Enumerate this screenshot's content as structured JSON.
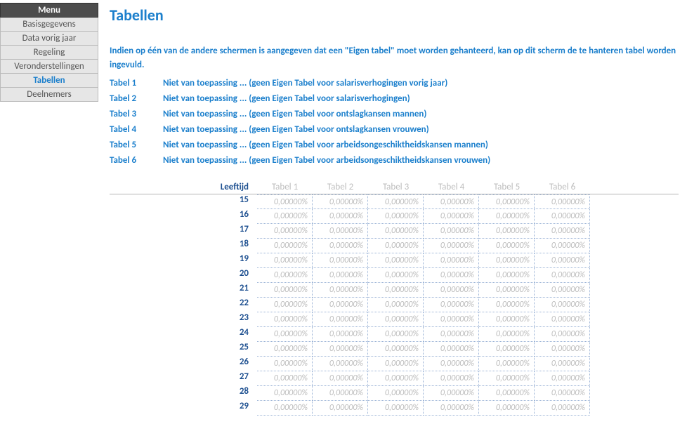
{
  "sidebar": {
    "header": "Menu",
    "items": [
      {
        "label": "Basisgegevens",
        "active": false
      },
      {
        "label": "Data vorig jaar",
        "active": false
      },
      {
        "label": "Regeling",
        "active": false
      },
      {
        "label": "Veronderstellingen",
        "active": false
      },
      {
        "label": "Tabellen",
        "active": true
      },
      {
        "label": "Deelnemers",
        "active": false
      }
    ]
  },
  "main": {
    "title": "Tabellen",
    "intro": "Indien op één van de andere schermen is aangegeven dat een \"Eigen tabel\" moet worden gehanteerd, kan op dit scherm de te hanteren tabel worden ingevuld.",
    "tabellen": [
      {
        "name": "Tabel 1",
        "desc": "Niet van toepassing ... (geen Eigen Tabel voor salarisverhogingen vorig jaar)"
      },
      {
        "name": "Tabel 2",
        "desc": "Niet van toepassing ... (geen Eigen Tabel voor salarisverhogingen)"
      },
      {
        "name": "Tabel 3",
        "desc": "Niet van toepassing ... (geen Eigen Tabel voor ontslagkansen mannen)"
      },
      {
        "name": "Tabel 4",
        "desc": "Niet van toepassing ... (geen Eigen Tabel voor ontslagkansen vrouwen)"
      },
      {
        "name": "Tabel 5",
        "desc": "Niet van toepassing ... (geen Eigen Tabel voor arbeidsongeschiktheidskansen mannen)"
      },
      {
        "name": "Tabel 6",
        "desc": "Niet van toepassing ... (geen Eigen Tabel voor arbeidsongeschiktheidskansen vrouwen)"
      }
    ],
    "grid": {
      "age_header": "Leeftijd",
      "col_headers": [
        "Tabel 1",
        "Tabel 2",
        "Tabel 3",
        "Tabel 4",
        "Tabel 5",
        "Tabel 6"
      ],
      "ages": [
        "15",
        "16",
        "17",
        "18",
        "19",
        "20",
        "21",
        "22",
        "23",
        "24",
        "25",
        "26",
        "27",
        "28",
        "29"
      ],
      "cell_value": "0,00000%"
    }
  }
}
